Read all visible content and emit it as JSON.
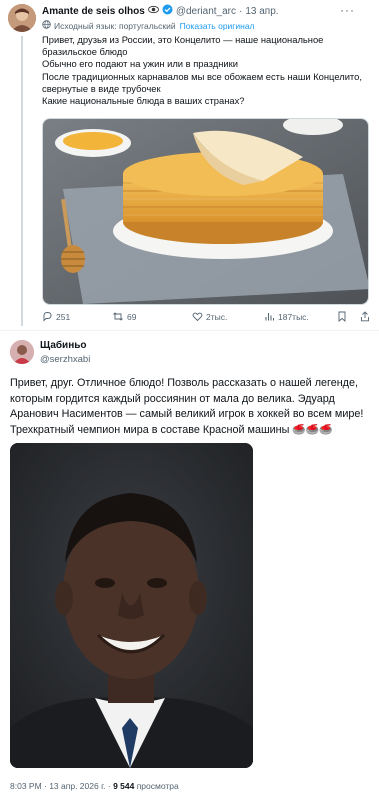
{
  "original_post": {
    "author_name": "Amante de seis olhos",
    "handle": "@deriant_arc",
    "date": "13 апр.",
    "translated_note": "Исходный язык: португальский",
    "show_original": "Показать оригинал",
    "text_lines": [
      "Привет, друзья из России, это Концелито — наше национальное",
      "бразильское блюдо",
      "Обычно его подают на ужин или в праздники",
      "После традиционных карнавалов мы все обожаем есть наши Концелито,",
      "свернутые в виде трубочек",
      "Какие национальные блюда в ваших странах?"
    ],
    "stats": {
      "replies": "251",
      "reposts": "69",
      "likes": "2тыс.",
      "views": "187тыс."
    }
  },
  "reply": {
    "author_name": "Щабиньо",
    "handle": "@serzhxabi",
    "text": "Привет, друг. Отличное блюдо! Позволь рассказать о нашей легенде, которым гордится каждый россиянин от мала до велика. Эдуард Аранович Насиментов — самый великий игрок в хоккей во всем мире! Трехкратный чемпион мира в составе Красной машины 🥌🥌🥌",
    "timestamp": "8:03 PM · 13 апр. 2026 г. · ",
    "views_count": "9 544",
    "views_label": " просмотра"
  },
  "colors": {
    "accent": "#1d9bf0",
    "secondary_text": "#536471",
    "border": "#cfd9de"
  },
  "icons": [
    "eye-icon",
    "verified-icon",
    "more-icon",
    "globe-icon",
    "reply-icon",
    "repost-icon",
    "like-icon",
    "views-icon",
    "bookmark-icon",
    "share-icon"
  ]
}
